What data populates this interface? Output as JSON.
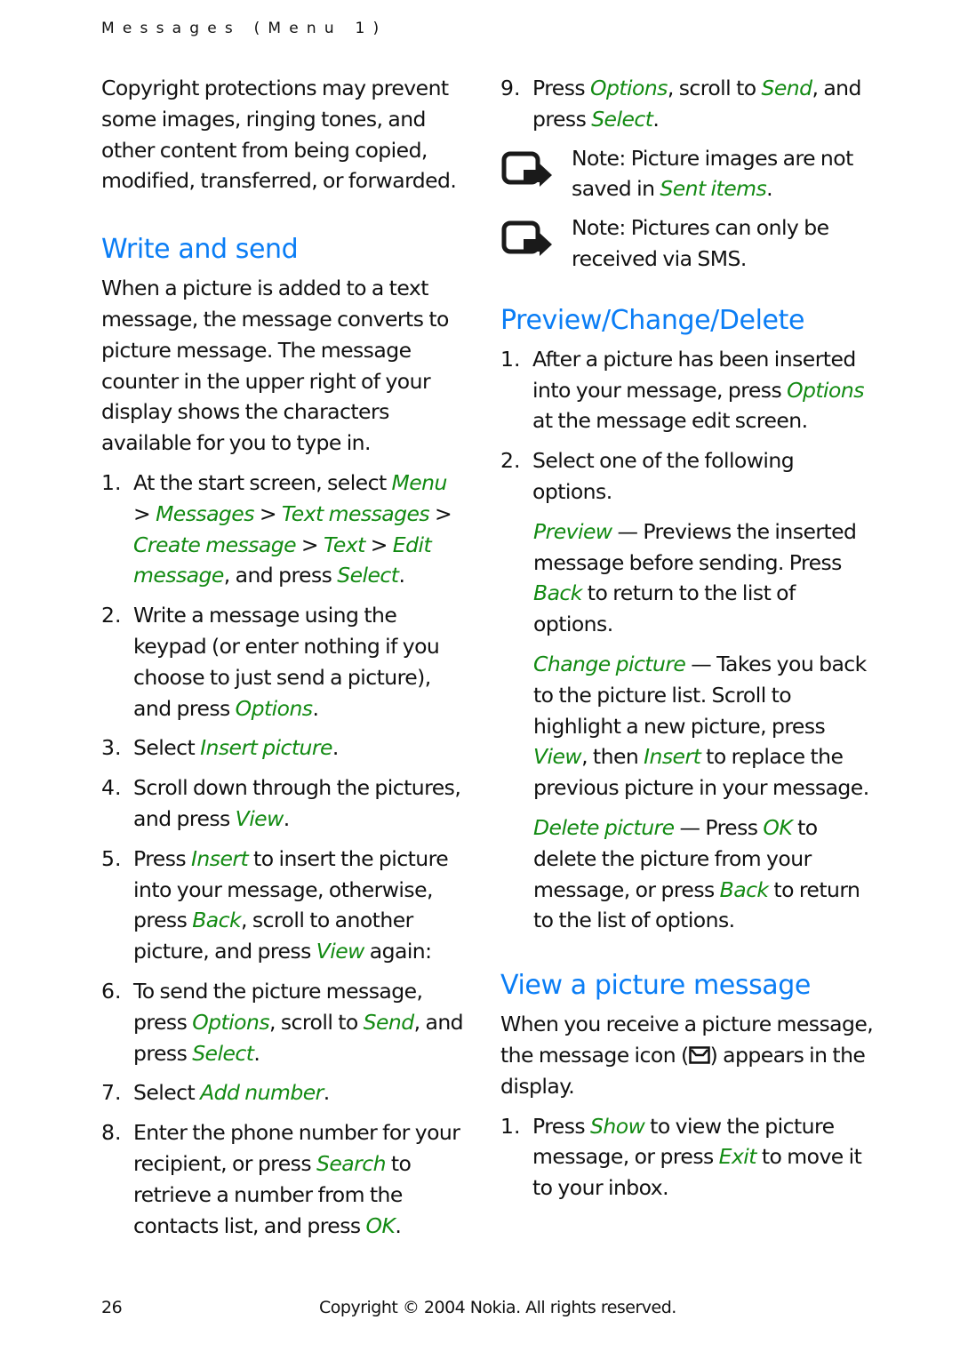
{
  "header": {
    "running_head": "Messages (Menu 1)"
  },
  "left_column": {
    "intro": "Copyright protections may prevent some images, ringing tones, and other content from being copied, modified, transferred, or forwarded.",
    "write_and_send": {
      "heading": "Write and send",
      "paragraph": "When a picture is added to a text message, the message converts to picture message. The message counter in the upper right of your display shows the characters available for you to type in.",
      "steps": [
        {
          "number": "1.",
          "parts": [
            {
              "t": "At the start screen, select "
            },
            {
              "t": "Menu",
              "link": true
            },
            {
              "t": " > "
            },
            {
              "t": "Messages",
              "link": true
            },
            {
              "t": " > "
            },
            {
              "t": "Text messages",
              "link": true
            },
            {
              "t": " > "
            },
            {
              "t": "Create message",
              "link": true
            },
            {
              "t": " > "
            },
            {
              "t": "Text",
              "link": true
            },
            {
              "t": " > "
            },
            {
              "t": "Edit message",
              "link": true
            },
            {
              "t": ", and press "
            },
            {
              "t": "Select",
              "link": true
            },
            {
              "t": "."
            }
          ]
        },
        {
          "number": "2.",
          "parts": [
            {
              "t": "Write a message using the keypad (or enter nothing if you choose to just send a picture), and press "
            },
            {
              "t": "Options",
              "link": true
            },
            {
              "t": "."
            }
          ]
        },
        {
          "number": "3.",
          "parts": [
            {
              "t": "Select "
            },
            {
              "t": "Insert picture",
              "link": true
            },
            {
              "t": "."
            }
          ]
        },
        {
          "number": "4.",
          "parts": [
            {
              "t": "Scroll down through the pictures, and press "
            },
            {
              "t": "View",
              "link": true
            },
            {
              "t": "."
            }
          ]
        },
        {
          "number": "5.",
          "parts": [
            {
              "t": "Press "
            },
            {
              "t": "Insert",
              "link": true
            },
            {
              "t": " to insert the picture into your message, otherwise, press "
            },
            {
              "t": "Back",
              "link": true
            },
            {
              "t": ", scroll to another picture, and press "
            },
            {
              "t": "View",
              "link": true
            },
            {
              "t": " again:"
            }
          ]
        },
        {
          "number": "6.",
          "parts": [
            {
              "t": "To send the picture message, press "
            },
            {
              "t": "Options",
              "link": true
            },
            {
              "t": ", scroll to "
            },
            {
              "t": "Send",
              "link": true
            },
            {
              "t": ", and press "
            },
            {
              "t": "Select",
              "link": true
            },
            {
              "t": "."
            }
          ]
        },
        {
          "number": "7.",
          "parts": [
            {
              "t": "Select "
            },
            {
              "t": "Add number",
              "link": true
            },
            {
              "t": "."
            }
          ]
        },
        {
          "number": "8.",
          "parts": [
            {
              "t": "Enter the phone number for your recipient, or press "
            },
            {
              "t": "Search",
              "link": true
            },
            {
              "t": " to retrieve a number from the contacts list, and press "
            },
            {
              "t": "OK",
              "link": true
            },
            {
              "t": "."
            }
          ]
        }
      ]
    }
  },
  "right_column": {
    "step9": {
      "number": "9.",
      "parts": [
        {
          "t": "Press "
        },
        {
          "t": "Options",
          "link": true
        },
        {
          "t": ", scroll to "
        },
        {
          "t": "Send",
          "link": true
        },
        {
          "t": ", and press "
        },
        {
          "t": "Select",
          "link": true
        },
        {
          "t": "."
        }
      ]
    },
    "notes": [
      {
        "icon": "note-arrow-icon",
        "label": "Note:",
        "parts": [
          {
            "t": " Picture images are not saved in "
          },
          {
            "t": "Sent items",
            "link": true
          },
          {
            "t": "."
          }
        ]
      },
      {
        "icon": "note-arrow-icon",
        "label": "Note:",
        "parts": [
          {
            "t": " Pictures can only be received via SMS."
          }
        ]
      }
    ],
    "preview_change_delete": {
      "heading": "Preview/Change/Delete",
      "steps": [
        {
          "number": "1.",
          "parts": [
            {
              "t": "After a picture has been inserted into your message, press "
            },
            {
              "t": "Options",
              "link": true
            },
            {
              "t": " at the message edit screen."
            }
          ]
        },
        {
          "number": "2.",
          "parts": [
            {
              "t": "Select one of the following options."
            }
          ]
        }
      ],
      "options": [
        {
          "parts": [
            {
              "t": "Preview",
              "link": true
            },
            {
              "t": " — Previews the inserted message before sending. Press "
            },
            {
              "t": "Back",
              "link": true
            },
            {
              "t": " to return to the list of options."
            }
          ]
        },
        {
          "parts": [
            {
              "t": "Change picture",
              "link": true
            },
            {
              "t": " — Takes you back to the picture list. Scroll to highlight a new picture, press "
            },
            {
              "t": "View",
              "link": true
            },
            {
              "t": ", then "
            },
            {
              "t": "Insert",
              "link": true
            },
            {
              "t": " to replace the previous picture in your message."
            }
          ]
        },
        {
          "parts": [
            {
              "t": "Delete picture",
              "link": true
            },
            {
              "t": " — Press "
            },
            {
              "t": "OK",
              "link": true
            },
            {
              "t": " to delete the picture from your message, or press "
            },
            {
              "t": "Back",
              "link": true
            },
            {
              "t": " to return to the list of options."
            }
          ]
        }
      ]
    },
    "view_picture_message": {
      "heading": "View a picture message",
      "paragraph_before_icon": "When you receive a picture message, the message icon (",
      "inline_icon": "envelope-icon",
      "paragraph_after_icon": ") appears in the display.",
      "steps": [
        {
          "number": "1.",
          "parts": [
            {
              "t": "Press "
            },
            {
              "t": "Show",
              "link": true
            },
            {
              "t": " to view the picture message, or press "
            },
            {
              "t": "Exit",
              "link": true
            },
            {
              "t": " to move it to your inbox."
            }
          ]
        }
      ]
    }
  },
  "footer": {
    "page_number": "26",
    "copyright": "Copyright © 2004 Nokia. All rights reserved."
  },
  "colors": {
    "heading_blue": "#0a7df5",
    "link_green": "#128a12",
    "text": "#111111"
  }
}
